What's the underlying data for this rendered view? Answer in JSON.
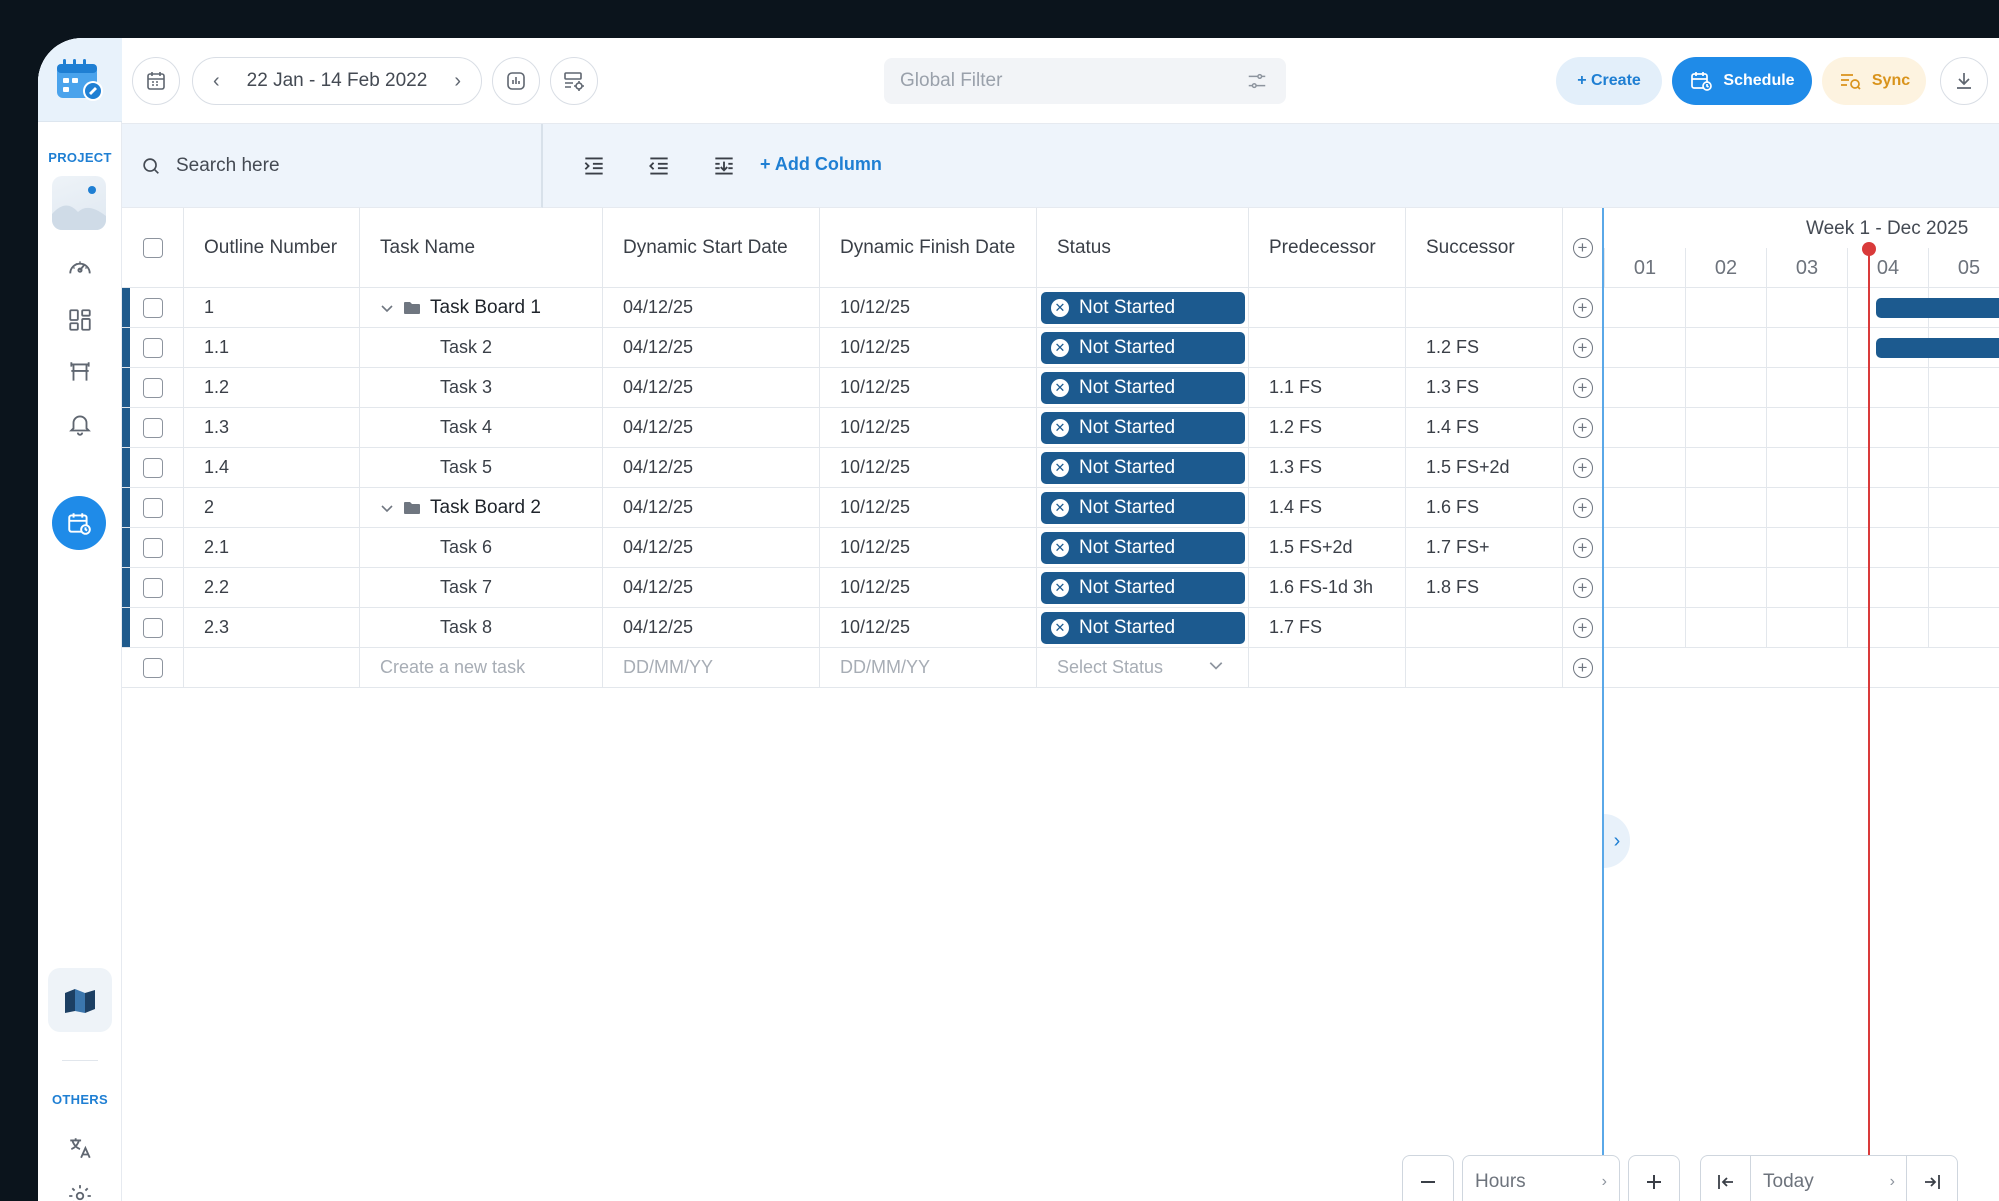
{
  "sidebar": {
    "project_label": "PROJECT",
    "others_label": "OTHERS",
    "icons": [
      "dashboard-icon",
      "grid-icon",
      "board-icon",
      "bell-icon",
      "schedule-icon",
      "translate-icon",
      "settings-icon"
    ]
  },
  "topbar": {
    "date_range": "22 Jan - 14 Feb 2022",
    "global_filter_placeholder": "Global Filter",
    "create_label": "+ Create",
    "schedule_label": "Schedule",
    "sync_label": "Sync"
  },
  "toolbar": {
    "search_placeholder": "Search here",
    "add_column_label": "+ Add Column"
  },
  "grid": {
    "headers": {
      "outline": "Outline Number",
      "name": "Task Name",
      "start": "Dynamic Start Date",
      "finish": "Dynamic Finish Date",
      "status": "Status",
      "pred": "Predecessor",
      "succ": "Successor"
    },
    "rows": [
      {
        "outline": "1",
        "name": "Task Board 1",
        "start": "04/12/25",
        "finish": "10/12/25",
        "status": "Not Started",
        "pred": "",
        "succ": ""
      },
      {
        "outline": "1.1",
        "name": "Task 2",
        "start": "04/12/25",
        "finish": "10/12/25",
        "status": "Not Started",
        "pred": "",
        "succ": "1.2 FS"
      },
      {
        "outline": "1.2",
        "name": "Task 3",
        "start": "04/12/25",
        "finish": "10/12/25",
        "status": "Not Started",
        "pred": "1.1 FS",
        "succ": "1.3 FS"
      },
      {
        "outline": "1.3",
        "name": "Task 4",
        "start": "04/12/25",
        "finish": "10/12/25",
        "status": "Not Started",
        "pred": "1.2 FS",
        "succ": "1.4 FS"
      },
      {
        "outline": "1.4",
        "name": "Task 5",
        "start": "04/12/25",
        "finish": "10/12/25",
        "status": "Not Started",
        "pred": "1.3 FS",
        "succ": "1.5 FS+2d"
      },
      {
        "outline": "2",
        "name": "Task Board 2",
        "start": "04/12/25",
        "finish": "10/12/25",
        "status": "Not Started",
        "pred": "1.4 FS",
        "succ": "1.6 FS"
      },
      {
        "outline": "2.1",
        "name": "Task 6",
        "start": "04/12/25",
        "finish": "10/12/25",
        "status": "Not Started",
        "pred": "1.5 FS+2d",
        "succ": "1.7 FS+"
      },
      {
        "outline": "2.2",
        "name": "Task 7",
        "start": "04/12/25",
        "finish": "10/12/25",
        "status": "Not Started",
        "pred": "1.6 FS-1d 3h",
        "succ": "1.8 FS"
      },
      {
        "outline": "2.3",
        "name": "Task 8",
        "start": "04/12/25",
        "finish": "10/12/25",
        "status": "Not Started",
        "pred": "1.7 FS",
        "succ": ""
      }
    ],
    "new_row": {
      "name_placeholder": "Create a new task",
      "date_placeholder": "DD/MM/YY",
      "status_placeholder": "Select Status"
    }
  },
  "gantt": {
    "week_label": "Week 1  - Dec 2025",
    "days": [
      "01",
      "02",
      "03",
      "04",
      "05"
    ]
  },
  "controls": {
    "zoom_unit": "Hours",
    "today_label": "Today"
  },
  "colors": {
    "accent": "#1f8be8",
    "status_badge": "#1c5a8f",
    "today_line": "#d93a3a",
    "sync": "#d9931b"
  }
}
